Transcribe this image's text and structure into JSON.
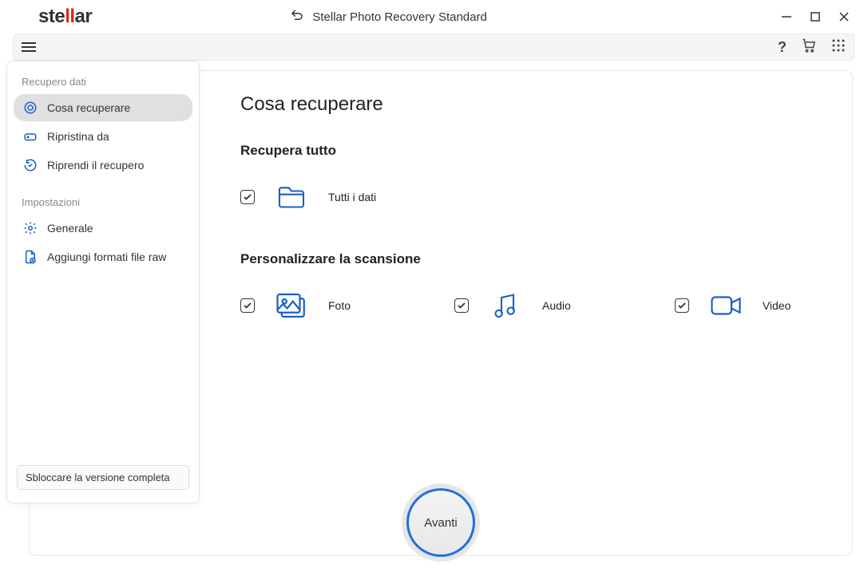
{
  "title": {
    "app": "Stellar Photo Recovery Standard",
    "logo_pre": "ste",
    "logo_ll": "ll",
    "logo_post": "ar"
  },
  "sidebar": {
    "section1": "Recupero dati",
    "items": [
      {
        "label": "Cosa recuperare"
      },
      {
        "label": "Ripristina da"
      },
      {
        "label": "Riprendi il recupero"
      }
    ],
    "section2": "Impostazioni",
    "items2": [
      {
        "label": "Generale"
      },
      {
        "label": "Aggiungi formati file raw"
      }
    ],
    "unlock": "Sbloccare la versione completa"
  },
  "main": {
    "title": "Cosa recuperare",
    "recover_all": "Recupera tutto",
    "all_data": "Tutti i dati",
    "customize": "Personalizzare la scansione",
    "photo": "Foto",
    "audio": "Audio",
    "video": "Video",
    "next": "Avanti"
  }
}
